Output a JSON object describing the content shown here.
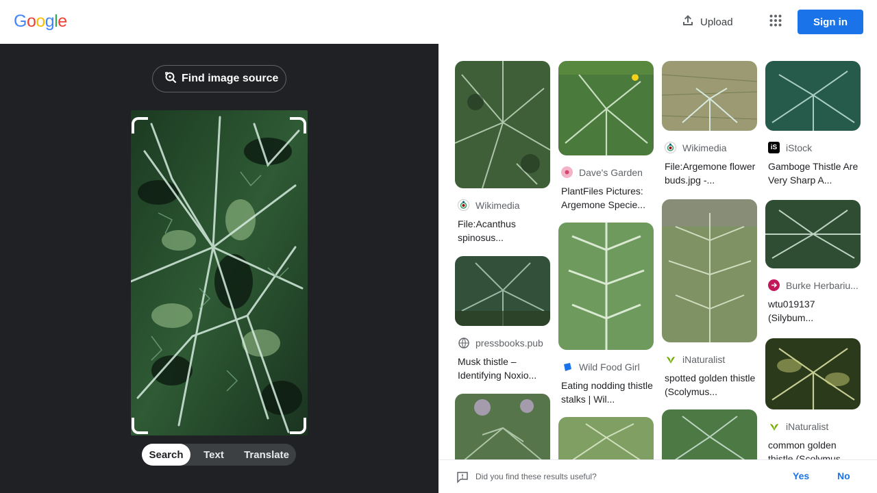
{
  "header": {
    "logo_letters": [
      {
        "ch": "G",
        "color": "#4285F4"
      },
      {
        "ch": "o",
        "color": "#EA4335"
      },
      {
        "ch": "o",
        "color": "#FBBC05"
      },
      {
        "ch": "g",
        "color": "#4285F4"
      },
      {
        "ch": "l",
        "color": "#34A853"
      },
      {
        "ch": "e",
        "color": "#EA4335"
      }
    ],
    "upload_label": "Upload",
    "upload_icon": "upload-icon",
    "apps_icon": "apps-grid-icon",
    "signin_label": "Sign in",
    "accent": "#1a73e8"
  },
  "left_panel": {
    "find_source_label": "Find image source",
    "find_source_icon": "lens-search-icon",
    "tabs": [
      {
        "label": "Search",
        "active": true
      },
      {
        "label": "Text",
        "active": false
      },
      {
        "label": "Translate",
        "active": false
      }
    ]
  },
  "results": {
    "col0": [
      {
        "source": "Wikimedia",
        "favicon": "wikimedia-icon",
        "title": "File:Acanthus spinosus..."
      },
      {
        "source": "pressbooks.pub",
        "favicon": "globe-icon",
        "title": "Musk thistle – Identifying Noxio..."
      }
    ],
    "col1": [
      {
        "source": "Dave's Garden",
        "favicon": "daves-garden-icon",
        "title": "PlantFiles Pictures: Argemone Specie..."
      },
      {
        "source": "Wild Food Girl",
        "favicon": "wild-food-girl-icon",
        "title": "Eating nodding thistle stalks | Wil..."
      }
    ],
    "col2": [
      {
        "source": "Wikimedia",
        "favicon": "wikimedia-icon",
        "title": "File:Argemone flower buds.jpg -..."
      },
      {
        "source": "iNaturalist",
        "favicon": "inaturalist-icon",
        "title": "spotted golden thistle (Scolymus..."
      }
    ],
    "col3": [
      {
        "source": "iStock",
        "favicon": "istock-icon",
        "title": "Gamboge Thistle Are Very Sharp A..."
      },
      {
        "source": "Burke Herbariu...",
        "favicon": "burke-herbarium-icon",
        "title": "wtu019137 (Silybum..."
      },
      {
        "source": "iNaturalist",
        "favicon": "inaturalist-icon",
        "title": "common golden thistle (Scolymus..."
      }
    ]
  },
  "feedback": {
    "question": "Did you find these results useful?",
    "yes_label": "Yes",
    "no_label": "No",
    "icon": "feedback-icon"
  }
}
